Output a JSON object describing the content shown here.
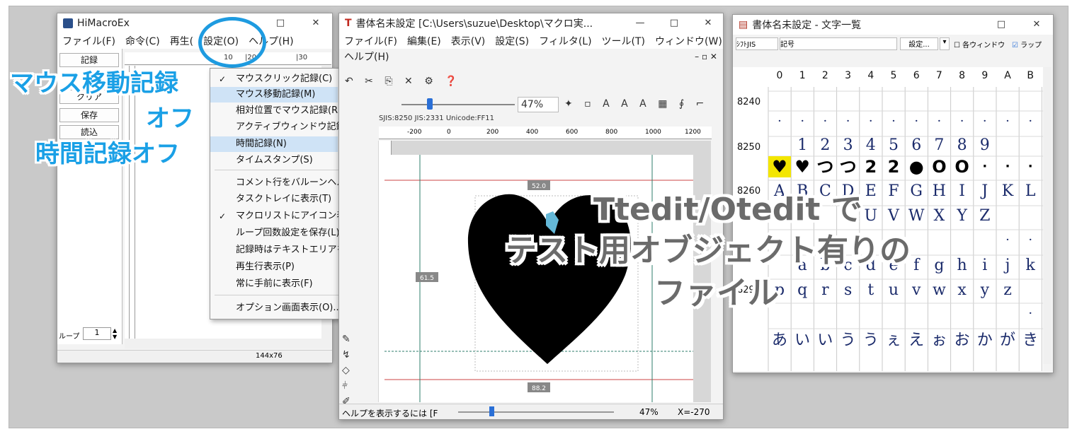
{
  "himacro": {
    "title": "HiMacroEx",
    "menu": [
      "ファイル(F)",
      "命令(C)",
      "再生(",
      "設定(O)",
      "ヘルプ(H)"
    ],
    "buttons": [
      "記録",
      "クリア",
      "保存",
      "読込"
    ],
    "ruler_labels": [
      "10",
      "|20",
      "|30"
    ],
    "loop_label": "ループ",
    "loop_value": "1",
    "status_size": "144x76"
  },
  "settings_menu": {
    "items": [
      {
        "label": "マウスクリック記録(C)",
        "checked": true
      },
      {
        "label": "マウス移動記録(M)",
        "checked": false,
        "highlight": true
      },
      {
        "label": "相対位置でマウス記録(R)",
        "checked": false
      },
      {
        "label": "アクティブウィンドウ記録(A)",
        "checked": false
      },
      {
        "label": "時間記録(N)",
        "checked": false,
        "highlight": true
      },
      {
        "label": "タイムスタンプ(S)",
        "checked": false
      },
      {
        "label": "コメント行をバルーンヘルプで表示",
        "checked": false
      },
      {
        "label": "タスクトレイに表示(T)",
        "checked": false
      },
      {
        "label": "マクロリストにアイコン表示(I)",
        "checked": true
      },
      {
        "label": "ループ回数設定を保存(L)",
        "checked": false
      },
      {
        "label": "記録時はテキストエリアを非表示",
        "checked": false
      },
      {
        "label": "再生行表示(P)",
        "checked": false
      },
      {
        "label": "常に手前に表示(F)",
        "checked": false
      },
      {
        "label": "オプション画面表示(O)...",
        "checked": false
      }
    ]
  },
  "ttedit": {
    "title": "書体名未設定 [C:\\Users\\suzue\\Desktop\\マクロ実...",
    "menu": [
      "ファイル(F)",
      "編集(E)",
      "表示(V)",
      "設定(S)",
      "フィルタ(L)",
      "ツール(T)",
      "ウィンドウ(W)"
    ],
    "menu2": "ヘルプ(H)",
    "zoom": "47%",
    "code_info": "SJIS:8250   JIS:2331   Unicode:FF11",
    "ruler_labels": [
      "-200",
      "0",
      "200",
      "400",
      "600",
      "800",
      "1000",
      "1200"
    ],
    "measure_top": "52.0",
    "measure_left": "61.5",
    "measure_bottom": "88.2",
    "status_help": "ヘルプを表示するには [F",
    "status_zoom": "47%",
    "status_x": "X=-270"
  },
  "charlist": {
    "title": "書体名未設定 - 文字一覧",
    "combo1": "ｼﾌﾄJIS",
    "combo2": "記号",
    "set_button": "設定...",
    "option1": "各ウィンドウ",
    "option2": "ラップ",
    "columns": [
      "0",
      "1",
      "2",
      "3",
      "4",
      "5",
      "6",
      "7",
      "8",
      "9",
      "A",
      "B"
    ],
    "rows": [
      {
        "code": "8240",
        "chars": [
          "",
          "",
          "",
          "",
          "",
          "",
          "",
          "",
          "",
          "",
          "",
          ""
        ]
      },
      {
        "code": "",
        "chars": [
          "·",
          "·",
          "·",
          "·",
          "·",
          "·",
          "·",
          "·",
          "·",
          "·",
          "·",
          "·"
        ]
      },
      {
        "code": "8250",
        "chars": [
          "",
          "1",
          "2",
          "3",
          "4",
          "5",
          "6",
          "7",
          "8",
          "9",
          "",
          ""
        ]
      },
      {
        "code": "",
        "chars": [
          "♥",
          "♥",
          "つ",
          "つ",
          "2",
          "2",
          "●",
          "O",
          "O",
          "·",
          "·",
          "·"
        ]
      },
      {
        "code": "8260",
        "chars": [
          "A",
          "B",
          "C",
          "D",
          "E",
          "F",
          "G",
          "H",
          "I",
          "J",
          "K",
          "L"
        ]
      },
      {
        "code": "",
        "chars": [
          "",
          "",
          "",
          "",
          "U",
          "V",
          "W",
          "X",
          "Y",
          "Z",
          "",
          ""
        ]
      },
      {
        "code": "",
        "chars": [
          "",
          "",
          "",
          "",
          "",
          "",
          "",
          "",
          "",
          "",
          "·",
          "·"
        ]
      },
      {
        "code": "",
        "chars": [
          "",
          "a",
          "b",
          "c",
          "d",
          "e",
          "f",
          "g",
          "h",
          "i",
          "j",
          "k"
        ]
      },
      {
        "code": "8290",
        "chars": [
          "p",
          "q",
          "r",
          "s",
          "t",
          "u",
          "v",
          "w",
          "x",
          "y",
          "z",
          ""
        ]
      },
      {
        "code": "",
        "chars": [
          "",
          "",
          "",
          "",
          "",
          "",
          "",
          "",
          "",
          "",
          "",
          "·"
        ]
      },
      {
        "code": "",
        "chars": [
          "あ",
          "い",
          "い",
          "う",
          "う",
          "ぇ",
          "え",
          "ぉ",
          "お",
          "か",
          "が",
          "き"
        ]
      }
    ]
  },
  "callouts": {
    "mouse_off_1": "マウス移動記録",
    "mouse_off_2": "オフ",
    "time_off": "時間記録オフ",
    "ttedit_line1": "Ttedit/Otedit で",
    "ttedit_line2": "テスト用オブジェクト有りの",
    "ttedit_line3": "ファイル"
  },
  "colors": {
    "accent": "#1e9be0",
    "highlight": "#cfe3f6",
    "yellow_cell": "#f3e600"
  }
}
